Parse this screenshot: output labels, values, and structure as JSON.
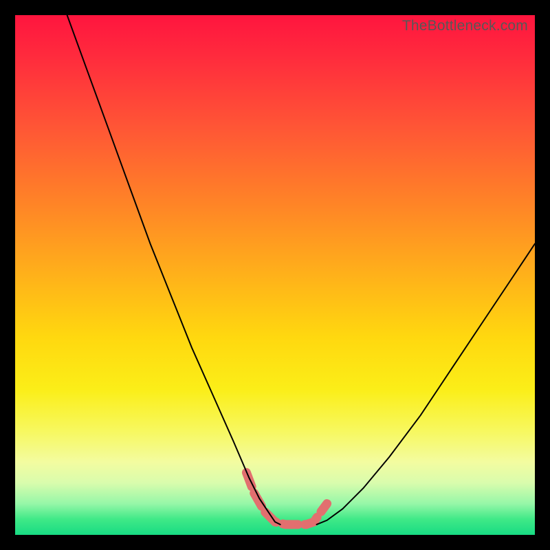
{
  "watermark": "TheBottleneck.com",
  "chart_data": {
    "type": "line",
    "title": "",
    "xlabel": "",
    "ylabel": "",
    "xlim": [
      0,
      100
    ],
    "ylim": [
      0,
      100
    ],
    "series": [
      {
        "name": "left-branch",
        "x": [
          10,
          14,
          18,
          22,
          26,
          30,
          34,
          38,
          42,
          45,
          47,
          49,
          50,
          51
        ],
        "y": [
          100,
          89,
          78,
          67,
          56,
          46,
          36,
          27,
          18,
          11,
          7,
          4,
          2.5,
          2
        ],
        "stroke": "#000000",
        "width": 2
      },
      {
        "name": "right-branch",
        "x": [
          58,
          60,
          63,
          67,
          72,
          78,
          84,
          90,
          96,
          100
        ],
        "y": [
          2,
          2.8,
          5,
          9,
          15,
          23,
          32,
          41,
          50,
          56
        ],
        "stroke": "#000000",
        "width": 2
      },
      {
        "name": "valley-highlight",
        "x": [
          44.5,
          46,
          48,
          50,
          52,
          54,
          56,
          57.5,
          58.5,
          60
        ],
        "y": [
          12,
          8,
          4.5,
          2.5,
          2,
          2,
          2,
          2.5,
          4,
          6
        ],
        "stroke": "#e26f6f",
        "width": 13,
        "dash": "22 10"
      }
    ]
  }
}
